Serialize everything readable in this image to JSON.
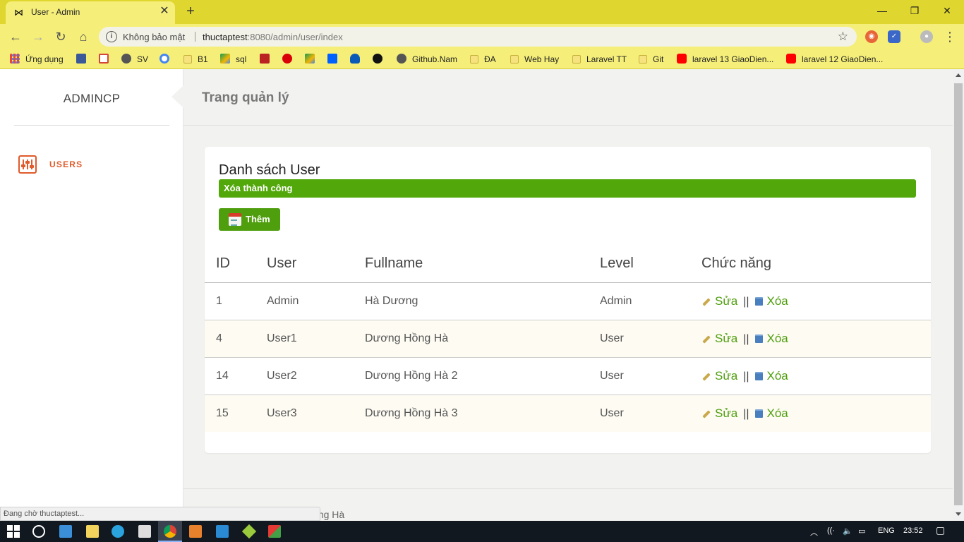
{
  "browser": {
    "tab_title": "User - Admin",
    "security_label": "Không bảo mật",
    "url_host": "thuctaptest",
    "url_rest": ":8080/admin/user/index",
    "status_text": "Đang chờ thuctaptest...",
    "theme_color": "#dfd62f",
    "bookmarks": [
      {
        "label": "Ứng dụng",
        "icon": "apps-grid-icon"
      },
      {
        "label": "",
        "icon": "facebook-icon"
      },
      {
        "label": "",
        "icon": "gmail-icon"
      },
      {
        "label": "SV",
        "icon": "globe-icon"
      },
      {
        "label": "",
        "icon": "google-icon"
      },
      {
        "label": "B1",
        "icon": "folder-icon"
      },
      {
        "label": "sql",
        "icon": "drive-icon"
      },
      {
        "label": "",
        "icon": "shield-crest-icon"
      },
      {
        "label": "",
        "icon": "mega-icon"
      },
      {
        "label": "",
        "icon": "drive-icon"
      },
      {
        "label": "",
        "icon": "dropbox-icon"
      },
      {
        "label": "",
        "icon": "onedrive-icon"
      },
      {
        "label": "",
        "icon": "github-icon"
      },
      {
        "label": "Github.Nam",
        "icon": "globe-icon"
      },
      {
        "label": "ĐA",
        "icon": "folder-icon"
      },
      {
        "label": "Web Hay",
        "icon": "folder-icon"
      },
      {
        "label": "Laravel TT",
        "icon": "folder-icon"
      },
      {
        "label": "Git",
        "icon": "folder-icon"
      },
      {
        "label": "laravel 13 GiaoDien...",
        "icon": "youtube-icon"
      },
      {
        "label": "laravel 12 GiaoDien...",
        "icon": "youtube-icon"
      }
    ]
  },
  "sidebar": {
    "brand": "ADMINCP",
    "items": [
      {
        "label": "USERS",
        "icon": "sliders-icon"
      }
    ],
    "accent_color": "#e05a2a"
  },
  "header": {
    "title": "Trang quản lý"
  },
  "card": {
    "title": "Danh sách User",
    "alert": "Xóa thành công",
    "add_label": "Thêm"
  },
  "table": {
    "columns": [
      "ID",
      "User",
      "Fullname",
      "Level",
      "Chức năng"
    ],
    "rows": [
      {
        "id": "1",
        "user": "Admin",
        "fullname": "Hà Dương",
        "level": "Admin"
      },
      {
        "id": "4",
        "user": "User1",
        "fullname": "Dương Hồng Hà",
        "level": "User"
      },
      {
        "id": "14",
        "user": "User2",
        "fullname": "Dương Hồng Hà 2",
        "level": "User"
      },
      {
        "id": "15",
        "user": "User3",
        "fullname": "Dương Hồng Hà 3",
        "level": "User"
      }
    ],
    "edit_label": "Sửa",
    "delete_label": "Xóa",
    "separator": "||"
  },
  "footer": {
    "text": "Thực hiện bởi: Dương Hồng Hà"
  },
  "taskbar": {
    "language": "ENG",
    "time": "23:52"
  }
}
